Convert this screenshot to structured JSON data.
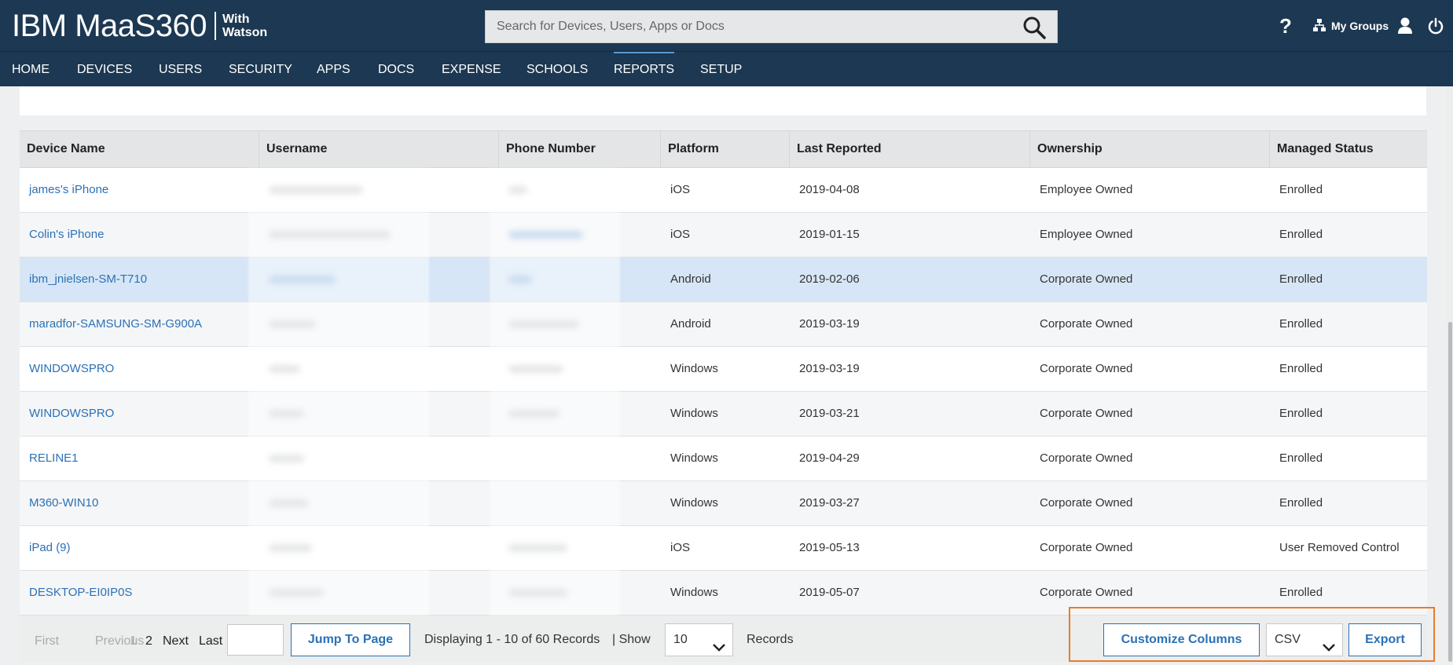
{
  "header": {
    "logo_main": "IBM MaaS360",
    "logo_sub": "With\nWatson",
    "search_placeholder": "Search for Devices, Users, Apps or Docs",
    "help_label": "?",
    "my_groups_label": "My Groups"
  },
  "nav": {
    "items": [
      {
        "label": "HOME"
      },
      {
        "label": "DEVICES"
      },
      {
        "label": "USERS"
      },
      {
        "label": "SECURITY"
      },
      {
        "label": "APPS"
      },
      {
        "label": "DOCS"
      },
      {
        "label": "EXPENSE"
      },
      {
        "label": "SCHOOLS"
      },
      {
        "label": "REPORTS",
        "active": true
      },
      {
        "label": "SETUP"
      }
    ]
  },
  "table": {
    "columns": [
      "Device Name",
      "Username",
      "Phone Number",
      "Platform",
      "Last Reported",
      "Ownership",
      "Managed Status"
    ],
    "rows": [
      {
        "device": "james's iPhone",
        "platform": "iOS",
        "last_reported": "2019-04-08",
        "ownership": "Employee Owned",
        "status": "Enrolled"
      },
      {
        "device": "Colin's iPhone",
        "platform": "iOS",
        "last_reported": "2019-01-15",
        "ownership": "Employee Owned",
        "status": "Enrolled"
      },
      {
        "device": "ibm_jnielsen-SM-T710",
        "platform": "Android",
        "last_reported": "2019-02-06",
        "ownership": "Corporate Owned",
        "status": "Enrolled",
        "selected": true
      },
      {
        "device": "maradfor-SAMSUNG-SM-G900A",
        "platform": "Android",
        "last_reported": "2019-03-19",
        "ownership": "Corporate Owned",
        "status": "Enrolled"
      },
      {
        "device": "WINDOWSPRO",
        "platform": "Windows",
        "last_reported": "2019-03-19",
        "ownership": "Corporate Owned",
        "status": "Enrolled"
      },
      {
        "device": "WINDOWSPRO",
        "platform": "Windows",
        "last_reported": "2019-03-21",
        "ownership": "Corporate Owned",
        "status": "Enrolled"
      },
      {
        "device": "RELINE1",
        "platform": "Windows",
        "last_reported": "2019-04-29",
        "ownership": "Corporate Owned",
        "status": "Enrolled"
      },
      {
        "device": "M360-WIN10",
        "platform": "Windows",
        "last_reported": "2019-03-27",
        "ownership": "Corporate Owned",
        "status": "Enrolled"
      },
      {
        "device": "iPad (9)",
        "platform": "iOS",
        "last_reported": "2019-05-13",
        "ownership": "Corporate Owned",
        "status": "User Removed Control"
      },
      {
        "device": "DESKTOP-EI0IP0S",
        "platform": "Windows",
        "last_reported": "2019-05-07",
        "ownership": "Corporate Owned",
        "status": "Enrolled"
      }
    ]
  },
  "footer": {
    "first": "First",
    "previous": "Previous",
    "pages": [
      "1",
      "2"
    ],
    "next": "Next",
    "last": "Last",
    "jump_value": "",
    "jump_label": "Jump To Page",
    "displaying": "Displaying 1 - 10 of 60 Records",
    "show_label": "| Show",
    "page_size": "10",
    "records_label": "Records",
    "customize_label": "Customize Columns",
    "format_value": "CSV",
    "export_label": "Export"
  },
  "colors": {
    "header_bg": "#1c3852",
    "link": "#2b71b7",
    "selected_row": "#d7e6f6",
    "highlight_box": "#e87c2b"
  }
}
